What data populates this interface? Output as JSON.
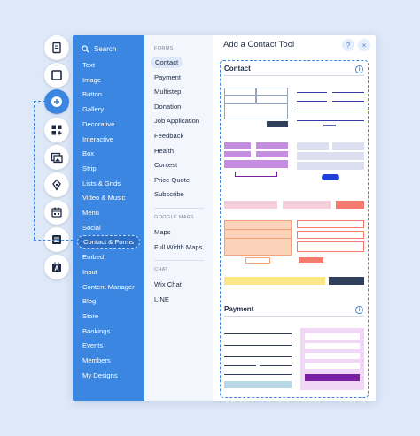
{
  "rail": {
    "icons": [
      "page-icon",
      "square-icon",
      "add-icon",
      "apps-icon",
      "media-icon",
      "pen-icon",
      "app-market-icon",
      "table-icon",
      "text-icon"
    ]
  },
  "panel": {
    "search_label": "Search",
    "categories": [
      "Text",
      "Image",
      "Button",
      "Gallery",
      "Decorative",
      "Interactive",
      "Box",
      "Strip",
      "Lists & Grids",
      "Video & Music",
      "Menu",
      "Social",
      "Contact & Forms",
      "Embed",
      "Input",
      "Content Manager",
      "Blog",
      "Store",
      "Bookings",
      "Events",
      "Members",
      "My Designs"
    ],
    "active_category": "Contact & Forms",
    "forms_header": "FORMS",
    "forms": [
      "Contact",
      "Payment",
      "Multistep",
      "Donation",
      "Job Application",
      "Feedback",
      "Health",
      "Contest",
      "Price Quote",
      "Subscribe"
    ],
    "maps_header": "GOOGLE MAPS",
    "maps": [
      "Maps",
      "Full Width Maps"
    ],
    "chat_header": "CHAT",
    "chat": [
      "Wix Chat",
      "LINE"
    ],
    "title": "Add a Contact Tool",
    "help": "?",
    "close": "×",
    "contact_section": "Contact",
    "payment_section": "Payment",
    "info": "i"
  },
  "colors": {
    "accent": "#3b86e0",
    "purple": "#7a1fa2",
    "salmon": "#f47a6e",
    "peach": "#fcd2b8",
    "yellow": "#fde58a",
    "navy": "#2f3e5a"
  }
}
